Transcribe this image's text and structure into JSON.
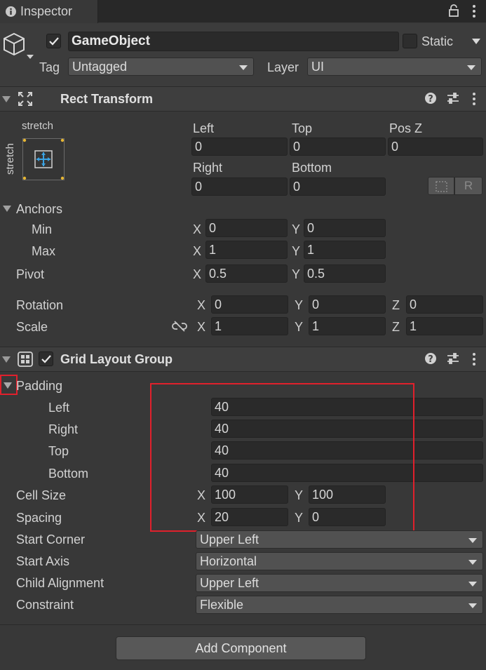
{
  "window": {
    "tab_label": "Inspector",
    "tab_icon": "info-icon"
  },
  "gameobject": {
    "active": true,
    "name": "GameObject",
    "static_label": "Static",
    "tag_label": "Tag",
    "tag_value": "Untagged",
    "layer_label": "Layer",
    "layer_value": "UI"
  },
  "rect_transform": {
    "title": "Rect Transform",
    "anchor_preset_h": "stretch",
    "anchor_preset_v": "stretch",
    "left_label": "Left",
    "left_value": "0",
    "top_label": "Top",
    "top_value": "0",
    "posz_label": "Pos Z",
    "posz_value": "0",
    "right_label": "Right",
    "right_value": "0",
    "bottom_label": "Bottom",
    "bottom_value": "0",
    "raw_button": "R",
    "anchors_label": "Anchors",
    "min_label": "Min",
    "min_x": "0",
    "min_y": "0",
    "max_label": "Max",
    "max_x": "1",
    "max_y": "1",
    "pivot_label": "Pivot",
    "pivot_x": "0.5",
    "pivot_y": "0.5",
    "rotation_label": "Rotation",
    "rotation_x": "0",
    "rotation_y": "0",
    "rotation_z": "0",
    "scale_label": "Scale",
    "scale_x": "1",
    "scale_y": "1",
    "scale_z": "1",
    "x": "X",
    "y": "Y",
    "z": "Z"
  },
  "grid_layout": {
    "title": "Grid Layout Group",
    "enabled": true,
    "padding_label": "Padding",
    "padding_left_label": "Left",
    "padding_left": "40",
    "padding_right_label": "Right",
    "padding_right": "40",
    "padding_top_label": "Top",
    "padding_top": "40",
    "padding_bottom_label": "Bottom",
    "padding_bottom": "40",
    "cell_size_label": "Cell Size",
    "cell_x": "100",
    "cell_y": "100",
    "spacing_label": "Spacing",
    "spacing_x": "20",
    "spacing_y": "0",
    "start_corner_label": "Start Corner",
    "start_corner": "Upper Left",
    "start_axis_label": "Start Axis",
    "start_axis": "Horizontal",
    "child_alignment_label": "Child Alignment",
    "child_alignment": "Upper Left",
    "constraint_label": "Constraint",
    "constraint": "Flexible"
  },
  "footer": {
    "add_component": "Add Component"
  },
  "colors": {
    "background": "#383838",
    "field": "#2a2a2a",
    "dropdown": "#515151",
    "highlight": "#e0202c",
    "accent": "#3aa3e3"
  }
}
